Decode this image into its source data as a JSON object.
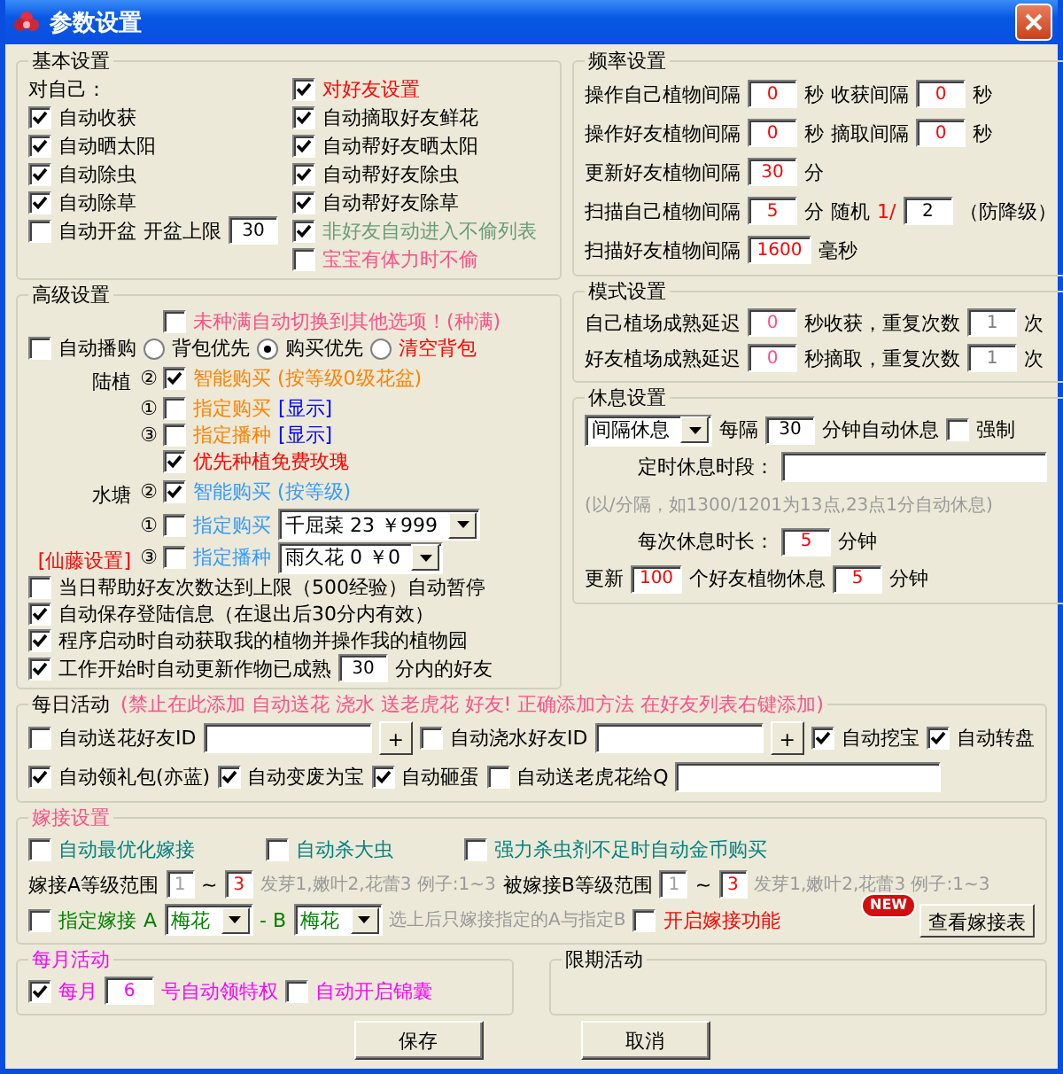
{
  "window": {
    "title": "参数设置"
  },
  "basic": {
    "title": "基本设置",
    "rows": [
      {
        "kind": "pair",
        "left": [
          {
            "kind": "text",
            "text": "对自己："
          }
        ],
        "right": [
          {
            "kind": "check",
            "label": "对好友设置",
            "checked": true,
            "color": "#ff0000"
          }
        ]
      },
      {
        "kind": "pair",
        "left": [
          {
            "kind": "check",
            "label": "自动收获",
            "checked": true
          }
        ],
        "right": [
          {
            "kind": "check",
            "label": "自动摘取好友鲜花",
            "checked": true
          }
        ]
      },
      {
        "kind": "pair",
        "left": [
          {
            "kind": "check",
            "label": "自动晒太阳",
            "checked": true
          }
        ],
        "right": [
          {
            "kind": "check",
            "label": "自动帮好友晒太阳",
            "checked": true
          }
        ]
      },
      {
        "kind": "pair",
        "left": [
          {
            "kind": "check",
            "label": "自动除虫",
            "checked": true
          }
        ],
        "right": [
          {
            "kind": "check",
            "label": "自动帮好友除虫",
            "checked": true
          }
        ]
      },
      {
        "kind": "pair",
        "left": [
          {
            "kind": "check",
            "label": "自动除草",
            "checked": true
          }
        ],
        "right": [
          {
            "kind": "check",
            "label": "自动帮好友除草",
            "checked": true
          }
        ]
      },
      {
        "kind": "pair",
        "left": [
          {
            "kind": "check",
            "label": "自动开盆",
            "checked": false
          },
          {
            "kind": "text",
            "text": "开盆上限"
          },
          {
            "kind": "field",
            "value": "30"
          }
        ],
        "right": [
          {
            "kind": "check",
            "label": "非好友自动进入不偷列表",
            "checked": true,
            "color": "#6a9a7a"
          }
        ]
      },
      {
        "kind": "pair",
        "right": [
          {
            "kind": "check",
            "label": "宝宝有体力时不偷",
            "checked": false,
            "color": "#ff4f87"
          }
        ]
      }
    ]
  },
  "frequency": {
    "title": "频率设置",
    "rows": [
      {
        "kind": "plain",
        "items": [
          {
            "kind": "text",
            "text": "操作自己植物间隔"
          },
          {
            "kind": "field",
            "value": "0",
            "color": "#ff0000"
          },
          {
            "kind": "text",
            "text": "秒"
          },
          {
            "kind": "text",
            "text": "收获间隔"
          },
          {
            "kind": "field",
            "value": "0",
            "color": "#ff0000"
          },
          {
            "kind": "text",
            "text": "秒"
          }
        ]
      },
      {
        "kind": "plain",
        "items": [
          {
            "kind": "text",
            "text": "操作好友植物间隔"
          },
          {
            "kind": "field",
            "value": "0",
            "color": "#ff0000"
          },
          {
            "kind": "text",
            "text": "秒"
          },
          {
            "kind": "text",
            "text": "摘取间隔"
          },
          {
            "kind": "field",
            "value": "0",
            "color": "#ff0000"
          },
          {
            "kind": "text",
            "text": "秒"
          }
        ]
      },
      {
        "kind": "plain",
        "items": [
          {
            "kind": "text",
            "text": "更新好友植物间隔"
          },
          {
            "kind": "field",
            "value": "30",
            "color": "#ff0000"
          },
          {
            "kind": "text",
            "text": "分"
          }
        ]
      },
      {
        "kind": "plain",
        "items": [
          {
            "kind": "text",
            "text": "扫描自己植物间隔"
          },
          {
            "kind": "field",
            "value": "5",
            "color": "#ff0000"
          },
          {
            "kind": "text",
            "text": "分"
          },
          {
            "kind": "text",
            "text": "随机"
          },
          {
            "kind": "text",
            "text": "1/",
            "color": "#ff0000"
          },
          {
            "kind": "field",
            "value": "2"
          },
          {
            "kind": "text",
            "text": "（防降级）"
          }
        ]
      },
      {
        "kind": "plain",
        "items": [
          {
            "kind": "text",
            "text": "扫描好友植物间隔"
          },
          {
            "kind": "field",
            "value": "1600",
            "color": "#ff0000"
          },
          {
            "kind": "text",
            "text": "毫秒"
          }
        ]
      }
    ]
  },
  "advanced": {
    "title": "高级设置",
    "rows": [
      {
        "kind": "slot",
        "items": [
          {
            "kind": "check",
            "label": "未种满自动切换到其他选项！(种满)",
            "checked": false,
            "color": "#ff4f87"
          }
        ]
      },
      {
        "kind": "plain",
        "items": [
          {
            "kind": "check",
            "label": "自动播购",
            "checked": false
          },
          {
            "kind": "radio",
            "label": "背包优先",
            "selected": false
          },
          {
            "kind": "radio",
            "label": "购买优先",
            "selected": true
          },
          {
            "kind": "radio",
            "label": "清空背包",
            "selected": false,
            "color": "#ff0000"
          }
        ]
      },
      {
        "kind": "slot",
        "side": {
          "text": "陆植"
        },
        "order": "②",
        "items": [
          {
            "kind": "check",
            "label": "智能购买 (按等级0级花盆)",
            "checked": true,
            "color": "#ff8000"
          }
        ]
      },
      {
        "kind": "slot",
        "order": "①",
        "items": [
          {
            "kind": "check",
            "label": "指定购买",
            "checked": false,
            "color": "#ff8000"
          },
          {
            "kind": "link",
            "text": "[显示]",
            "color": "#0000ff"
          }
        ]
      },
      {
        "kind": "slot",
        "order": "③",
        "items": [
          {
            "kind": "check",
            "label": "指定播种",
            "checked": false,
            "color": "#ff8000"
          },
          {
            "kind": "link",
            "text": "[显示]",
            "color": "#0000ff"
          }
        ]
      },
      {
        "kind": "slot",
        "items": [
          {
            "kind": "check",
            "label": "优先种植免费玫瑰",
            "checked": true,
            "color": "#ff0000"
          }
        ]
      },
      {
        "kind": "slot",
        "side": {
          "text": "水塘"
        },
        "order": "②",
        "items": [
          {
            "kind": "check",
            "label": "智能购买 (按等级)",
            "checked": true,
            "color": "#3399ff"
          }
        ]
      },
      {
        "kind": "slot",
        "order": "①",
        "items": [
          {
            "kind": "check",
            "label": "指定购买",
            "checked": false,
            "color": "#3399ff"
          },
          {
            "kind": "select",
            "value": "千屈菜 23 ￥999"
          }
        ]
      },
      {
        "kind": "slot",
        "side": {
          "text": "[仙藤设置]",
          "color": "#ff0000"
        },
        "order": "③",
        "items": [
          {
            "kind": "check",
            "label": "指定播种",
            "checked": false,
            "color": "#3399ff"
          },
          {
            "kind": "select",
            "value": "雨久花 0 ￥0"
          }
        ]
      },
      {
        "kind": "plain",
        "items": [
          {
            "kind": "check",
            "label": "当日帮助好友次数达到上限（500经验）自动暂停",
            "checked": false
          }
        ]
      },
      {
        "kind": "plain",
        "items": [
          {
            "kind": "check",
            "label": "自动保存登陆信息（在退出后30分内有效）",
            "checked": true
          }
        ]
      },
      {
        "kind": "plain",
        "items": [
          {
            "kind": "check",
            "label": "程序启动时自动获取我的植物并操作我的植物园",
            "checked": true
          }
        ]
      },
      {
        "kind": "plain",
        "items": [
          {
            "kind": "check",
            "label": "工作开始时自动更新作物已成熟",
            "checked": true
          },
          {
            "kind": "field",
            "value": "30"
          },
          {
            "kind": "text",
            "text": "分内的好友"
          }
        ]
      }
    ]
  },
  "mode": {
    "title": "模式设置",
    "rows": [
      {
        "kind": "plain",
        "items": [
          {
            "kind": "text",
            "text": "自己植场成熟延迟"
          },
          {
            "kind": "field",
            "value": "0",
            "color": "#ff4f87"
          },
          {
            "kind": "text",
            "text": "秒收获，重复次数"
          },
          {
            "kind": "field",
            "value": "1",
            "color": "#808080"
          },
          {
            "kind": "text",
            "text": "次"
          }
        ]
      },
      {
        "kind": "plain",
        "items": [
          {
            "kind": "text",
            "text": "好友植场成熟延迟"
          },
          {
            "kind": "field",
            "value": "0",
            "color": "#ff4f87"
          },
          {
            "kind": "text",
            "text": "秒摘取，重复次数"
          },
          {
            "kind": "field",
            "value": "1",
            "color": "#808080"
          },
          {
            "kind": "text",
            "text": "次"
          }
        ]
      }
    ]
  },
  "rest": {
    "title": "休息设置",
    "rows": [
      {
        "kind": "plain",
        "items": [
          {
            "kind": "select",
            "value": "间隔休息"
          },
          {
            "kind": "text",
            "text": "每隔"
          },
          {
            "kind": "field",
            "value": "30"
          },
          {
            "kind": "text",
            "text": "分钟自动休息"
          },
          {
            "kind": "check",
            "label": "强制",
            "checked": false
          }
        ]
      },
      {
        "kind": "indent",
        "items": [
          {
            "kind": "text",
            "text": "定时休息时段："
          },
          {
            "kind": "entry"
          }
        ]
      },
      {
        "kind": "plain",
        "items": [
          {
            "kind": "hint",
            "text": "(以/分隔，如1300/1201为13点,23点1分自动休息)"
          }
        ]
      },
      {
        "kind": "indent",
        "items": [
          {
            "kind": "text",
            "text": "每次休息时长："
          },
          {
            "kind": "field",
            "value": "5",
            "color": "#ff0000"
          },
          {
            "kind": "text",
            "text": "分钟"
          }
        ]
      },
      {
        "kind": "plain",
        "items": [
          {
            "kind": "text",
            "text": "更新"
          },
          {
            "kind": "field",
            "value": "100",
            "color": "#ff0000"
          },
          {
            "kind": "text",
            "text": "个好友植物休息"
          },
          {
            "kind": "field",
            "value": "5",
            "color": "#ff0000"
          },
          {
            "kind": "text",
            "text": "分钟"
          }
        ]
      }
    ]
  },
  "daily": {
    "title": "每日活动",
    "note": "(禁止在此添加 自动送花 浇水 送老虎花 好友!  正确添加方法 在好友列表右键添加)",
    "rows": [
      {
        "kind": "plain",
        "items": [
          {
            "kind": "check",
            "label": "自动送花好友ID",
            "checked": false
          },
          {
            "kind": "entry"
          },
          {
            "kind": "button",
            "label": "+"
          },
          {
            "kind": "check",
            "label": "自动浇水好友ID",
            "checked": false
          },
          {
            "kind": "entry"
          },
          {
            "kind": "button",
            "label": "+"
          },
          {
            "kind": "check",
            "label": "自动挖宝",
            "checked": true
          },
          {
            "kind": "check",
            "label": "自动转盘",
            "checked": true
          }
        ]
      },
      {
        "kind": "plain",
        "items": [
          {
            "kind": "check",
            "label": "自动领礼包(亦蓝)",
            "checked": true
          },
          {
            "kind": "check",
            "label": "自动变废为宝",
            "checked": true
          },
          {
            "kind": "check",
            "label": "自动砸蛋",
            "checked": true
          },
          {
            "kind": "check",
            "label": "自动送老虎花给Q",
            "checked": false
          },
          {
            "kind": "entry"
          }
        ]
      }
    ]
  },
  "graft": {
    "title": "嫁接设置",
    "color": "#ff4f87",
    "rows": [
      {
        "kind": "wide",
        "items": [
          {
            "kind": "check",
            "label": "自动最优化嫁接",
            "checked": false,
            "color": "#008080"
          },
          {
            "kind": "check",
            "label": "自动杀大虫",
            "checked": false,
            "color": "#008080"
          },
          {
            "kind": "check",
            "label": "强力杀虫剂不足时自动金币购买",
            "checked": false,
            "color": "#008080"
          }
        ]
      },
      {
        "kind": "plain",
        "items": [
          {
            "kind": "text",
            "text": "嫁接A等级范围"
          },
          {
            "kind": "digit",
            "value": "1",
            "color": "#a0a0a0"
          },
          {
            "kind": "text",
            "text": "~"
          },
          {
            "kind": "digit",
            "value": "3",
            "color": "#ff0000"
          },
          {
            "kind": "hint",
            "text": "发芽1,嫩叶2,花蕾3 例子:1~3"
          },
          {
            "kind": "text",
            "text": "被嫁接B等级范围"
          },
          {
            "kind": "digit",
            "value": "1",
            "color": "#a0a0a0"
          },
          {
            "kind": "text",
            "text": "~"
          },
          {
            "kind": "digit",
            "value": "3",
            "color": "#ff0000"
          },
          {
            "kind": "hint",
            "text": "发芽1,嫩叶2,花蕾3 例子:1~3"
          }
        ]
      },
      {
        "kind": "plain",
        "items": [
          {
            "kind": "check",
            "label": "指定嫁接",
            "checked": false,
            "color": "#008000"
          },
          {
            "kind": "text",
            "text": "A",
            "color": "#008000"
          },
          {
            "kind": "select",
            "value": "梅花",
            "color": "#008000"
          },
          {
            "kind": "text",
            "text": "- B",
            "color": "#008000"
          },
          {
            "kind": "select",
            "value": "梅花",
            "color": "#008000"
          },
          {
            "kind": "hint",
            "text": "选上后只嫁接指定的A与指定B"
          },
          {
            "kind": "check",
            "label": "开启嫁接功能",
            "checked": false,
            "color": "#ff0000"
          },
          {
            "kind": "button",
            "label": "查看嫁接表",
            "badge": "NEW"
          }
        ]
      }
    ]
  },
  "monthly": {
    "title": "每月活动",
    "color": "#ff00ff",
    "rows": [
      {
        "kind": "plain",
        "items": [
          {
            "kind": "check",
            "label": "每月",
            "checked": true,
            "color": "#ff00ff"
          },
          {
            "kind": "field",
            "value": "6",
            "color": "#ff00ff"
          },
          {
            "kind": "text",
            "text": "号自动领特权",
            "color": "#ff00ff"
          },
          {
            "kind": "check",
            "label": "自动开启锦囊",
            "checked": false,
            "color": "#ff00ff"
          }
        ]
      }
    ]
  },
  "limited": {
    "title": "限期活动"
  },
  "buttons": [
    "保存",
    "取消"
  ]
}
